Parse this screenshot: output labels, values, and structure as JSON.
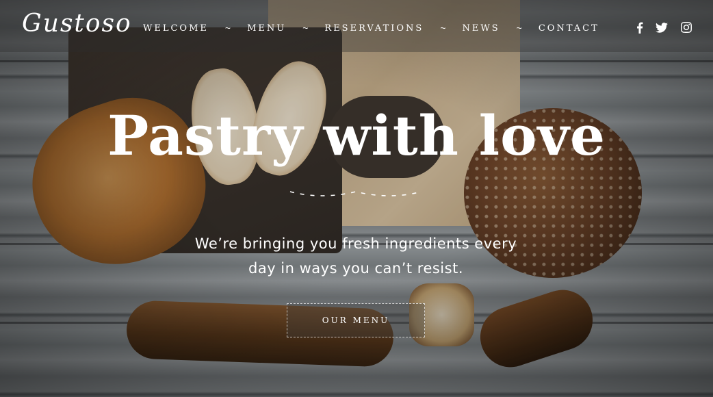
{
  "brand": {
    "logo_text": "Gustoso"
  },
  "nav": {
    "items": [
      {
        "label": "WELCOME"
      },
      {
        "label": "MENU"
      },
      {
        "label": "RESERVATIONS"
      },
      {
        "label": "NEWS"
      },
      {
        "label": "CONTACT"
      }
    ],
    "separator": "~"
  },
  "social": {
    "icons": [
      "facebook-icon",
      "twitter-icon",
      "instagram-icon"
    ]
  },
  "hero": {
    "title": "Pastry with love",
    "subtitle_line1": "We’re bringing you fresh ingredients every",
    "subtitle_line2": "day in ways you can’t resist.",
    "cta_label": "OUR MENU"
  },
  "colors": {
    "text": "#ffffff",
    "header_overlay": "#2d2d2d"
  }
}
